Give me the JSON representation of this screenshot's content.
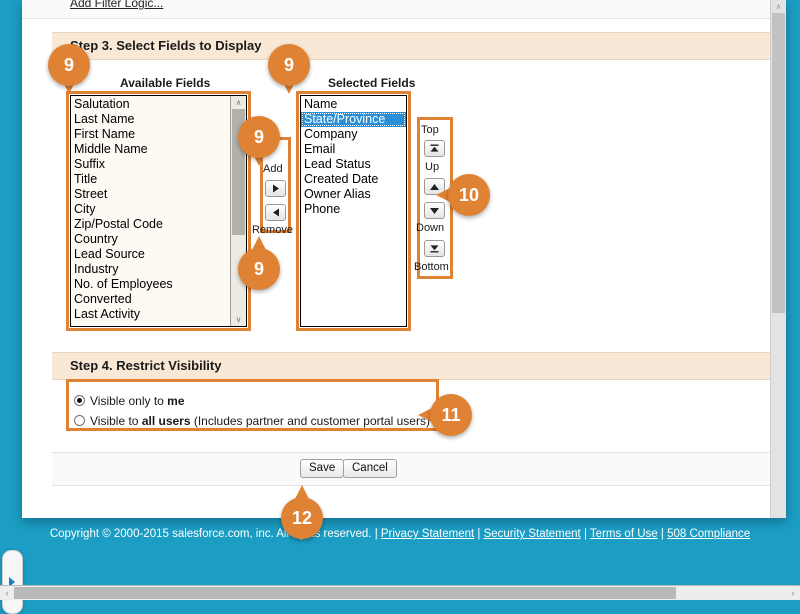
{
  "filter": {
    "add_filter_logic_label": "Add Filter Logic..."
  },
  "step3": {
    "title": "Step 3. Select Fields to Display",
    "available_heading": "Available Fields",
    "selected_heading": "Selected Fields",
    "available_fields": [
      "Salutation",
      "Last Name",
      "First Name",
      "Middle Name",
      "Suffix",
      "Title",
      "Street",
      "City",
      "Zip/Postal Code",
      "Country",
      "Lead Source",
      "Industry",
      "No. of Employees",
      "Converted",
      "Last Activity"
    ],
    "selected_fields": [
      "Name",
      "State/Province",
      "Company",
      "Email",
      "Lead Status",
      "Created Date",
      "Owner Alias",
      "Phone"
    ],
    "selected_highlight": "State/Province",
    "transfer": {
      "add_label": "Add",
      "remove_label": "Remove",
      "add_icon": "arrow-right-icon",
      "remove_icon": "arrow-left-icon"
    },
    "order": {
      "top_label": "Top",
      "up_label": "Up",
      "down_label": "Down",
      "bottom_label": "Bottom",
      "top_icon": "move-to-top-icon",
      "up_icon": "move-up-icon",
      "down_icon": "move-down-icon",
      "bottom_icon": "move-to-bottom-icon"
    }
  },
  "step4": {
    "title": "Step 4. Restrict Visibility",
    "options": [
      {
        "prefix": "Visible only to ",
        "strong": "me",
        "suffix": "",
        "selected": true
      },
      {
        "prefix": "Visible to ",
        "strong": "all users",
        "suffix": " (Includes partner and customer portal users)",
        "selected": false
      }
    ]
  },
  "actions": {
    "save_label": "Save",
    "cancel_label": "Cancel"
  },
  "footer": {
    "copyright": "Copyright © 2000-2015 salesforce.com, inc. All rights reserved. | ",
    "privacy": "Privacy Statement",
    "sep1": " | ",
    "security": "Security Statement",
    "sep2": " | ",
    "terms": "Terms of Use",
    "sep3": " | ",
    "compliance": "508 Compliance"
  },
  "callouts": [
    {
      "id": "co-9a",
      "number": "9",
      "direction": "down"
    },
    {
      "id": "co-9b",
      "number": "9",
      "direction": "down"
    },
    {
      "id": "co-9c",
      "number": "9",
      "direction": "down"
    },
    {
      "id": "co-9d",
      "number": "9",
      "direction": "up"
    },
    {
      "id": "co-10",
      "number": "10",
      "direction": "left"
    },
    {
      "id": "co-11",
      "number": "11",
      "direction": "left"
    },
    {
      "id": "co-12",
      "number": "12",
      "direction": "up"
    }
  ],
  "icons": {
    "scroll_up": "∧",
    "scroll_down": "∨",
    "h_left": "‹",
    "h_right": "›",
    "sidebar_toggle": "sidebar-expand-icon"
  },
  "colors": {
    "accent_orange": "#E08233",
    "band_peach": "#F8E8D5",
    "teal": "#1B9DC4",
    "selection_blue": "#2A8FD4"
  }
}
